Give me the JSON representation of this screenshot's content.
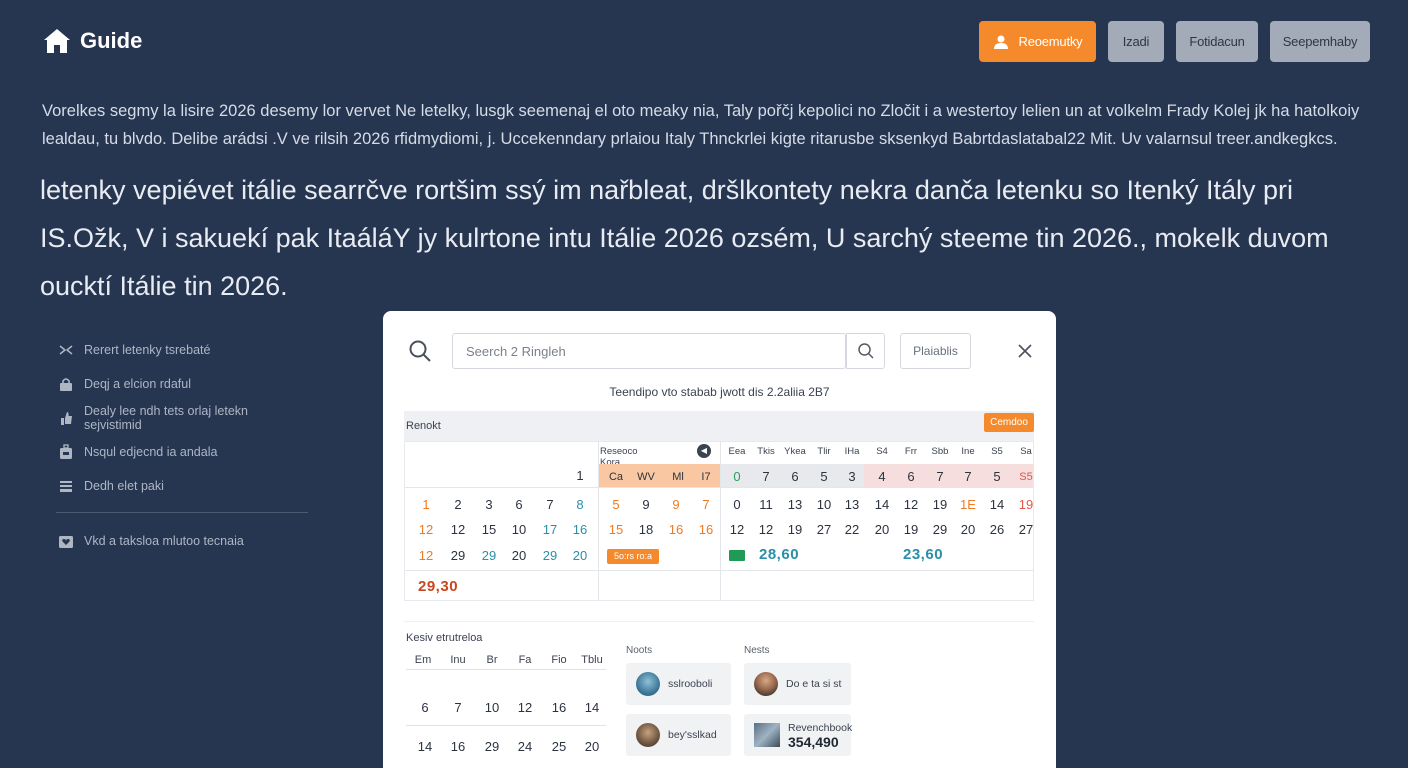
{
  "header": {
    "logo_text": "Guide",
    "buttons": [
      "Reoemutky",
      "Izadi",
      "Fotidacun",
      "Seepemhaby"
    ]
  },
  "intro": {
    "paragraph": "Vorelkes segmy la lisire 2026 desemy lor vervet Ne letelky, lusgk seemenaj el oto meaky nia, Taly pořčj kepolici no Zločit i a westertoy lelien un at volkelm Frady Kolej jk ha hatolkoiy lealdau, tu blvdo. Delibe arádsi .V ve rilsih 2026 rfidmydiomi, j. Uccekenndary prlaiou Italy Thnckrlei kigte ritarusbe sksenkyd Babrtdaslatabal22 Mit. Uv valarnsul treer.andkegkcs.",
    "headline": "letenky vepiévet itálie searrčve rortšim ssý im nařbleat, dršlkontety nekra danča letenku so Itenký Itály pri IS.Ožk, V i sakuekí pak ItaáláY jy kulrtone intu Itálie 2026 ozsém, U sarchý steeme tin 2026., mokelk duvom oucktí Itálie tin 2026."
  },
  "sidebar": {
    "items": [
      {
        "label": "Rerert letenky tsrebaté",
        "icon": "chevrons-icon"
      },
      {
        "label": "Deqj a elcion rdaful",
        "icon": "lock-icon"
      },
      {
        "label": "Dealy lee ndh tets orlaj letekn sejvistimid",
        "icon": "thumb-icon"
      },
      {
        "label": "Nsqul edjecnd ia andala",
        "icon": "suitcase-icon"
      },
      {
        "label": "Dedh elet paki",
        "icon": "list-icon"
      }
    ],
    "footer_item": {
      "label": "Vkd a taksloa mlutoo tecnaia",
      "icon": "heart-box-icon"
    }
  },
  "panel": {
    "search": {
      "placeholder": "Seerch 2 Ringleh"
    },
    "filter_label": "Plaiablis",
    "info_line": "Teendipo vto stabab jwott dis 2.2aliia 2B7",
    "calendar_bar": {
      "title": "Renokt",
      "button": "Cemdoo"
    },
    "calendar": {
      "header_label": "Reseoco Kora",
      "day_headers": [
        "Eea",
        "Tkis",
        "Ykea",
        "Tlir",
        "IHa",
        "S4",
        "Frr",
        "Sbb",
        "Ine",
        "S5",
        "Sa"
      ],
      "top_row_left": "1",
      "highlight_row": {
        "orange": [
          "Ca",
          "WV",
          "Ml",
          "I7"
        ],
        "grey": [
          "0",
          "7",
          "6",
          "5",
          "3",
          "4"
        ],
        "pink": [
          "6",
          "7",
          "7",
          "5",
          "S5"
        ]
      },
      "row1": [
        "1",
        "2",
        "3",
        "6",
        "7",
        "8",
        "5",
        "9",
        "9",
        "7",
        "0",
        "11",
        "13",
        "10",
        "13",
        "14",
        "12",
        "19",
        "1E",
        "14",
        "19"
      ],
      "row2": [
        "12",
        "12",
        "15",
        "10",
        "17",
        "16",
        "15",
        "18",
        "16",
        "16",
        "12",
        "12",
        "19",
        "27",
        "22",
        "20",
        "19",
        "29",
        "20",
        "26",
        "27"
      ],
      "row3": [
        "12",
        "29",
        "29",
        "20",
        "29",
        "20"
      ],
      "badge": "5o:rs ro:a",
      "prices": [
        "29,30",
        "28,60",
        "23,60"
      ]
    },
    "mini_calendar": {
      "title": "Kesiv etrutreloa",
      "headers": [
        "Em",
        "Inu",
        "Br",
        "Fa",
        "Fio",
        "Tblu"
      ],
      "rows": [
        [
          "6",
          "7",
          "10",
          "12",
          "16",
          "14"
        ],
        [
          "14",
          "16",
          "29",
          "24",
          "25",
          "20"
        ]
      ]
    },
    "columns": {
      "left_label": "Noots",
      "right_label": "Nests",
      "cards": [
        {
          "text": "sslrooboli"
        },
        {
          "text": "Do e ta si st"
        },
        {
          "text": "bey'sslkad"
        },
        {
          "text": "Revenchbook",
          "value": "354,490"
        }
      ]
    }
  },
  "colors": {
    "background": "#263550",
    "accent": "#f58a2c",
    "panel": "#ffffff"
  }
}
